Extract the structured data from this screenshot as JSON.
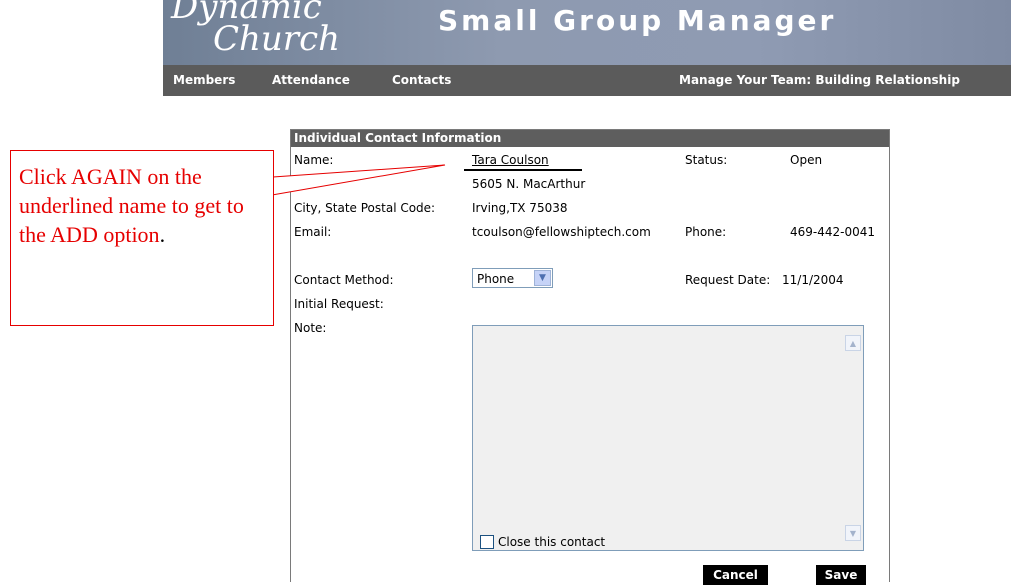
{
  "header": {
    "logo_line1": "Dynamic",
    "logo_line2": "Church",
    "app_title": "Small Group Manager"
  },
  "nav": {
    "items": [
      "Members",
      "Attendance",
      "Contacts"
    ],
    "tagline": "Manage Your Team: Building Relationship"
  },
  "panel": {
    "title": "Individual Contact Information",
    "name_label": "Name:",
    "name_value": "Tara Coulson",
    "status_label": "Status:",
    "status_value": "Open",
    "address": "5605 N. MacArthur",
    "city_label": "City, State Postal Code:",
    "city_value": "Irving,TX 75038",
    "email_label": "Email:",
    "email_value": "tcoulson@fellowshiptech.com",
    "phone_label": "Phone:",
    "phone_value": "469-442-0041",
    "contact_method_label": "Contact Method:",
    "contact_method_value": "Phone",
    "request_date_label": "Request Date:",
    "request_date_value": "11/1/2004",
    "initial_request_label": "Initial Request:",
    "note_label": "Note:",
    "note_value": "",
    "close_label": "Close this contact",
    "cancel_label": "Cancel",
    "save_label": "Save"
  },
  "callout": {
    "text": "Click AGAIN on the underlined  name to get to the ADD option",
    "trailing": ".",
    "color": "#e60000"
  }
}
